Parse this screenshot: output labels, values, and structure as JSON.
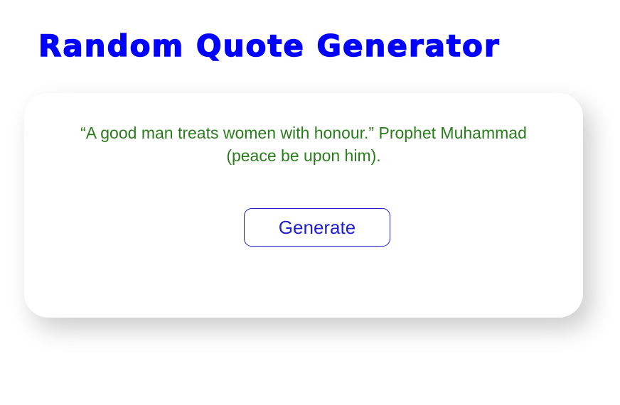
{
  "header": {
    "title": "Random Quote Generator"
  },
  "quote": {
    "text": "“A good man treats women with honour.” Prophet Muhammad (peace be upon him)."
  },
  "actions": {
    "generate_label": "Generate"
  },
  "colors": {
    "title": "#0000ff",
    "quote_text": "#2a7d1c",
    "button": "#1f1fcf",
    "background": "#ffffff"
  }
}
